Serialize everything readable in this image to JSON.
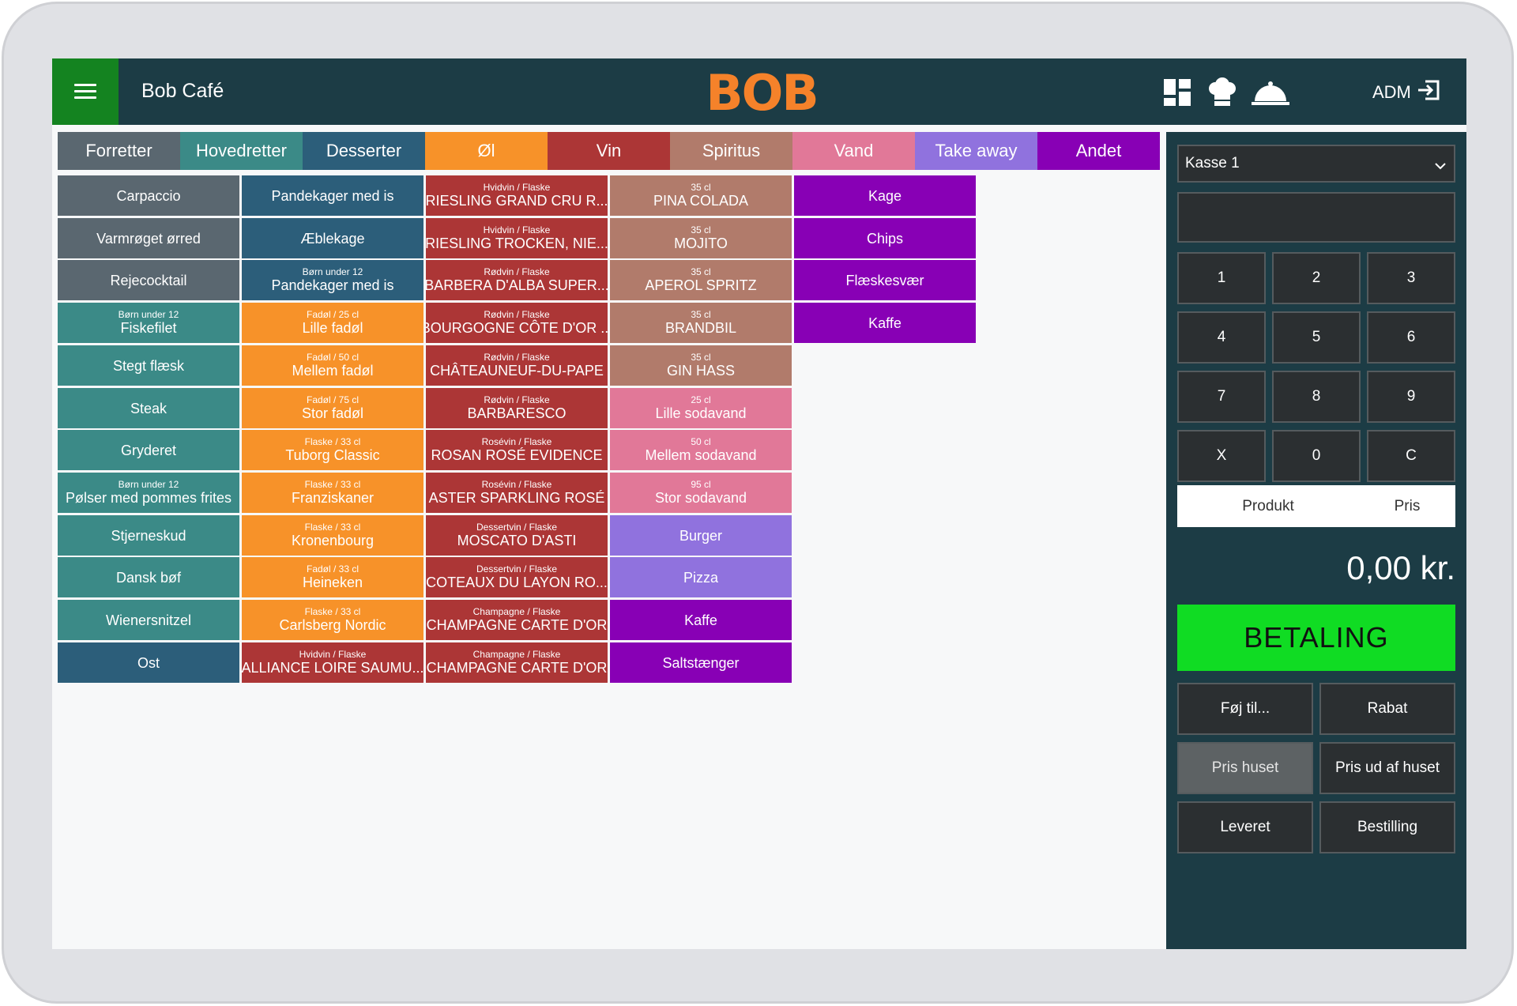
{
  "header": {
    "cafe_name": "Bob Café",
    "logo": "BOB",
    "user": "ADM",
    "icons": [
      "dashboard-icon",
      "chef-hat-icon",
      "cloche-icon",
      "logout-icon"
    ]
  },
  "tabs": [
    {
      "label": "Forretter",
      "color": "#5a6770"
    },
    {
      "label": "Hovedretter",
      "color": "#3b8a87"
    },
    {
      "label": "Desserter",
      "color": "#2c5e7a"
    },
    {
      "label": "Øl",
      "color": "#f79229"
    },
    {
      "label": "Vin",
      "color": "#ac3636"
    },
    {
      "label": "Spiritus",
      "color": "#b17b6b"
    },
    {
      "label": "Vand",
      "color": "#e17898"
    },
    {
      "label": "Take away",
      "color": "#9072de"
    },
    {
      "label": "Andet",
      "color": "#8800b5"
    }
  ],
  "columns": [
    [
      {
        "name": "Carpaccio",
        "sub": "",
        "color": "#5a6770"
      },
      {
        "name": "Varmrøget ørred",
        "sub": "",
        "color": "#5a6770"
      },
      {
        "name": "Rejecocktail",
        "sub": "",
        "color": "#5a6770"
      },
      {
        "name": "Fiskefilet",
        "sub": "Børn under 12",
        "color": "#3b8a87"
      },
      {
        "name": "Stegt flæsk",
        "sub": "",
        "color": "#3b8a87"
      },
      {
        "name": "Steak",
        "sub": "",
        "color": "#3b8a87"
      },
      {
        "name": "Gryderet",
        "sub": "",
        "color": "#3b8a87"
      },
      {
        "name": "Pølser med pommes frites",
        "sub": "Børn under 12",
        "color": "#3b8a87"
      },
      {
        "name": "Stjerneskud",
        "sub": "",
        "color": "#3b8a87"
      },
      {
        "name": "Dansk bøf",
        "sub": "",
        "color": "#3b8a87"
      },
      {
        "name": "Wienersnitzel",
        "sub": "",
        "color": "#3b8a87"
      },
      {
        "name": "Ost",
        "sub": "",
        "color": "#2c5e7a"
      }
    ],
    [
      {
        "name": "Pandekager med is",
        "sub": "",
        "color": "#2c5e7a"
      },
      {
        "name": "Æblekage",
        "sub": "",
        "color": "#2c5e7a"
      },
      {
        "name": "Pandekager med is",
        "sub": "Børn under 12",
        "color": "#2c5e7a"
      },
      {
        "name": "Lille fadøl",
        "sub": "Fadøl / 25 cl",
        "color": "#f79229"
      },
      {
        "name": "Mellem fadøl",
        "sub": "Fadøl / 50 cl",
        "color": "#f79229"
      },
      {
        "name": "Stor fadøl",
        "sub": "Fadøl / 75 cl",
        "color": "#f79229"
      },
      {
        "name": "Tuborg Classic",
        "sub": "Flaske / 33 cl",
        "color": "#f79229"
      },
      {
        "name": "Franziskaner",
        "sub": "Flaske / 33 cl",
        "color": "#f79229"
      },
      {
        "name": "Kronenbourg",
        "sub": "Flaske / 33 cl",
        "color": "#f79229"
      },
      {
        "name": "Heineken",
        "sub": "Fadøl / 33 cl",
        "color": "#f79229"
      },
      {
        "name": "Carlsberg Nordic",
        "sub": "Flaske / 33 cl",
        "color": "#f79229"
      },
      {
        "name": "ALLIANCE LOIRE SAUMU...",
        "sub": "Hvidvin / Flaske",
        "color": "#ac3636"
      }
    ],
    [
      {
        "name": "RIESLING GRAND CRU R...",
        "sub": "Hvidvin / Flaske",
        "color": "#ac3636"
      },
      {
        "name": "RIESLING TROCKEN, NIE...",
        "sub": "Hvidvin / Flaske",
        "color": "#ac3636"
      },
      {
        "name": "BARBERA D'ALBA SUPER...",
        "sub": "Rødvin / Flaske",
        "color": "#ac3636"
      },
      {
        "name": "BOURGOGNE CÔTE D'OR ...",
        "sub": "Rødvin / Flaske",
        "color": "#ac3636"
      },
      {
        "name": "CHÂTEAUNEUF-DU-PAPE",
        "sub": "Rødvin / Flaske",
        "color": "#ac3636"
      },
      {
        "name": "BARBARESCO",
        "sub": "Rødvin / Flaske",
        "color": "#ac3636"
      },
      {
        "name": "ROSAN ROSÉ EVIDENCE",
        "sub": "Rosévin / Flaske",
        "color": "#ac3636"
      },
      {
        "name": "ASTER SPARKLING ROSÉ",
        "sub": "Rosévin / Flaske",
        "color": "#ac3636"
      },
      {
        "name": "MOSCATO D'ASTI",
        "sub": "Dessertvin / Flaske",
        "color": "#ac3636"
      },
      {
        "name": "COTEAUX DU LAYON RO...",
        "sub": "Dessertvin / Flaske",
        "color": "#ac3636"
      },
      {
        "name": "CHAMPAGNE CARTE D'OR",
        "sub": "Champagne / Flaske",
        "color": "#ac3636"
      },
      {
        "name": "CHAMPAGNE CARTE D'OR",
        "sub": "Champagne / Flaske",
        "color": "#ac3636"
      }
    ],
    [
      {
        "name": "PINA COLADA",
        "sub": "35 cl",
        "color": "#b17b6b"
      },
      {
        "name": "MOJITO",
        "sub": "35 cl",
        "color": "#b17b6b"
      },
      {
        "name": "APEROL SPRITZ",
        "sub": "35 cl",
        "color": "#b17b6b"
      },
      {
        "name": "BRANDBIL",
        "sub": "35 cl",
        "color": "#b17b6b"
      },
      {
        "name": "GIN HASS",
        "sub": "35 cl",
        "color": "#b17b6b"
      },
      {
        "name": "Lille sodavand",
        "sub": "25 cl",
        "color": "#e17898"
      },
      {
        "name": "Mellem sodavand",
        "sub": "50 cl",
        "color": "#e17898"
      },
      {
        "name": "Stor sodavand",
        "sub": "95 cl",
        "color": "#e17898"
      },
      {
        "name": "Burger",
        "sub": "",
        "color": "#9072de"
      },
      {
        "name": "Pizza",
        "sub": "",
        "color": "#9072de"
      },
      {
        "name": "Kaffe",
        "sub": "",
        "color": "#8800b5"
      },
      {
        "name": "Saltstænger",
        "sub": "",
        "color": "#8800b5"
      }
    ],
    [
      {
        "name": "Kage",
        "sub": "",
        "color": "#8800b5"
      },
      {
        "name": "Chips",
        "sub": "",
        "color": "#8800b5"
      },
      {
        "name": "Flæskesvær",
        "sub": "",
        "color": "#8800b5"
      },
      {
        "name": "Kaffe",
        "sub": "",
        "color": "#8800b5"
      }
    ]
  ],
  "panel": {
    "register": "Kasse 1",
    "keypad": [
      "1",
      "2",
      "3",
      "4",
      "5",
      "6",
      "7",
      "8",
      "9",
      "X",
      "0",
      "C"
    ],
    "list_header": {
      "product": "Produkt",
      "price": "Pris"
    },
    "total": "0,00 kr.",
    "pay_label": "BETALING",
    "actions": [
      {
        "label": "Føj til...",
        "active": false
      },
      {
        "label": "Rabat",
        "active": false
      },
      {
        "label": "Pris huset",
        "active": true
      },
      {
        "label": "Pris ud af huset",
        "active": false
      },
      {
        "label": "Leveret",
        "active": false
      },
      {
        "label": "Bestilling",
        "active": false
      }
    ]
  }
}
